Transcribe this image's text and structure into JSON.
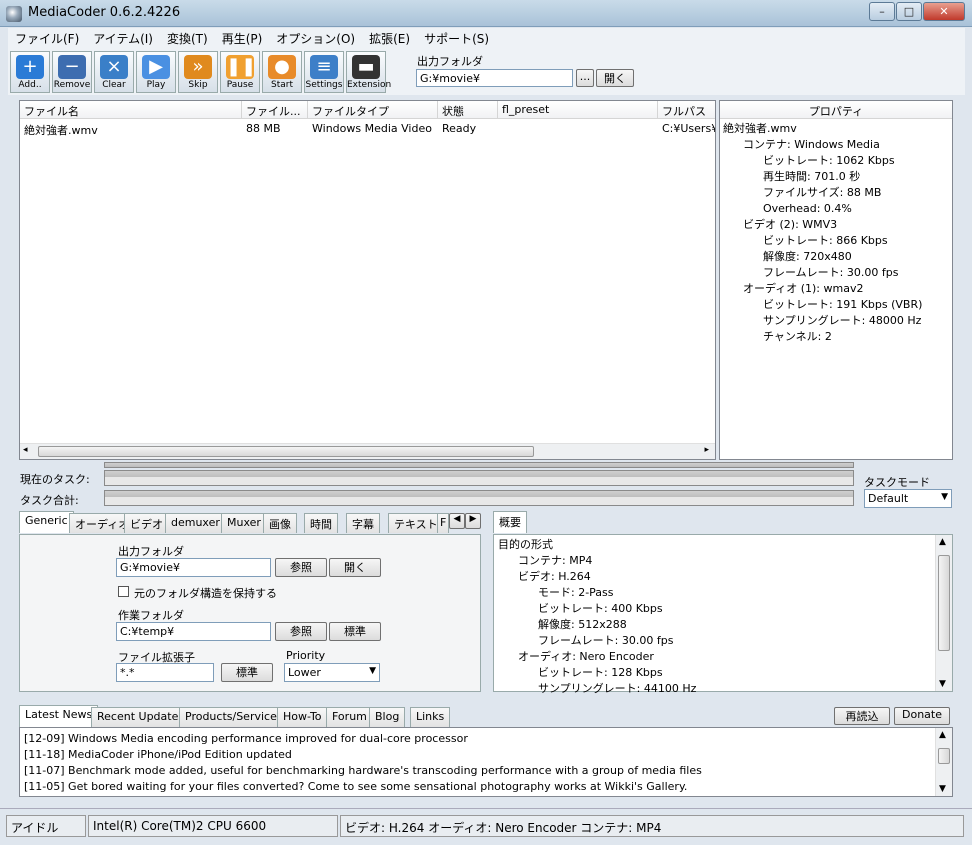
{
  "window": {
    "title": "MediaCoder 0.6.2.4226"
  },
  "menu": [
    "ファイル(F)",
    "アイテム(I)",
    "変換(T)",
    "再生(P)",
    "オプション(O)",
    "拡張(E)",
    "サポート(S)"
  ],
  "toolbar": {
    "buttons": [
      {
        "label": "Add..",
        "icon": "add-icon",
        "color": "#2b7bd6"
      },
      {
        "label": "Remove",
        "icon": "remove-icon",
        "color": "#3d6db0"
      },
      {
        "label": "Clear",
        "icon": "clear-icon",
        "color": "#3a7fc8"
      },
      {
        "label": "Play",
        "icon": "play-icon",
        "color": "#4a90e2"
      },
      {
        "label": "Skip",
        "icon": "skip-icon",
        "color": "#e08a1e"
      },
      {
        "label": "Pause",
        "icon": "pause-icon",
        "color": "#f0a030"
      },
      {
        "label": "Start",
        "icon": "start-icon",
        "color": "#e88b2a"
      },
      {
        "label": "Settings",
        "icon": "settings-icon",
        "color": "#3d7fc8"
      },
      {
        "label": "Extension",
        "icon": "extension-icon",
        "color": "#333333"
      }
    ],
    "output_folder_label": "出力フォルダ",
    "output_folder_value": "G:¥movie¥",
    "browse_label": "...",
    "open_label": "開く"
  },
  "filelist": {
    "columns": [
      "ファイル名",
      "ファイル...",
      "ファイルタイプ",
      "状態",
      "fl_preset",
      "フルパス"
    ],
    "rows": [
      {
        "name": "絶対強者.wmv",
        "size": "88 MB",
        "type": "Windows Media Video",
        "state": "Ready",
        "preset": "",
        "path": "C:¥Users¥"
      }
    ]
  },
  "properties": {
    "header": "プロパティ",
    "items": [
      {
        "text": "絶対強者.wmv",
        "level": 0
      },
      {
        "text": "コンテナ: Windows Media",
        "level": 1
      },
      {
        "text": "ビットレート: 1062 Kbps",
        "level": 2
      },
      {
        "text": "再生時間: 701.0 秒",
        "level": 2
      },
      {
        "text": "ファイルサイズ: 88 MB",
        "level": 2
      },
      {
        "text": "Overhead: 0.4%",
        "level": 2
      },
      {
        "text": "ビデオ (2): WMV3",
        "level": 1
      },
      {
        "text": "ビットレート: 866 Kbps",
        "level": 2
      },
      {
        "text": "解像度: 720x480",
        "level": 2
      },
      {
        "text": "フレームレート: 30.00 fps",
        "level": 2
      },
      {
        "text": "オーディオ (1): wmav2",
        "level": 1
      },
      {
        "text": "ビットレート: 191 Kbps (VBR)",
        "level": 2
      },
      {
        "text": "サンプリングレート: 48000 Hz",
        "level": 2
      },
      {
        "text": "チャンネル: 2",
        "level": 2
      }
    ]
  },
  "progress": {
    "current_task_label": "現在のタスク:",
    "total_task_label": "タスク合計:",
    "task_mode_label": "タスクモード",
    "task_mode_value": "Default"
  },
  "settings_tabs": [
    "Generic",
    "オーディオ",
    "ビデオ",
    "demuxer",
    "Muxer",
    "画像",
    "時間",
    "字幕",
    "テキスト",
    "F"
  ],
  "generic": {
    "output_folder_label": "出力フォルダ",
    "output_folder_value": "G:¥movie¥",
    "browse_label": "参照",
    "open_label": "開く",
    "keep_structure_label": "元のフォルダ構造を保持する",
    "work_folder_label": "作業フォルダ",
    "work_folder_value": "C:¥temp¥",
    "work_browse_label": "参照",
    "work_default_label": "標準",
    "ext_label": "ファイル拡張子",
    "ext_value": "*.*",
    "ext_default_label": "標準",
    "priority_label": "Priority",
    "priority_value": "Lower"
  },
  "summary": {
    "tab": "概要",
    "items": [
      {
        "text": "目的の形式",
        "level": 0
      },
      {
        "text": "コンテナ: MP4",
        "level": 1
      },
      {
        "text": "ビデオ: H.264",
        "level": 1
      },
      {
        "text": "モード: 2-Pass",
        "level": 2
      },
      {
        "text": "ビットレート: 400 Kbps",
        "level": 2
      },
      {
        "text": "解像度: 512x288",
        "level": 2
      },
      {
        "text": "フレームレート: 30.00 fps",
        "level": 2
      },
      {
        "text": "オーディオ: Nero Encoder",
        "level": 1
      },
      {
        "text": "ビットレート: 128 Kbps",
        "level": 2
      },
      {
        "text": "サンプリングレート: 44100 Hz",
        "level": 2
      }
    ]
  },
  "news": {
    "tabs": [
      "Latest News",
      "Recent Updates",
      "Products/Services",
      "How-To",
      "Forum",
      "Blog",
      "Links"
    ],
    "reload_label": "再読込",
    "donate_label": "Donate",
    "lines": [
      "[12-09] Windows Media encoding performance improved for dual-core processor",
      "[11-18] MediaCoder iPhone/iPod Edition updated",
      "[11-07] Benchmark mode added, useful for benchmarking hardware's transcoding performance with a group of media files",
      "[11-05] Get bored waiting for your files converted? Come to see some sensational photography works at Wikki's Gallery."
    ]
  },
  "status": {
    "state": "アイドル",
    "cpu": "Intel(R) Core(TM)2 CPU 6600",
    "summary": "ビデオ: H.264  オーディオ: Nero Encoder  コンテナ: MP4"
  }
}
